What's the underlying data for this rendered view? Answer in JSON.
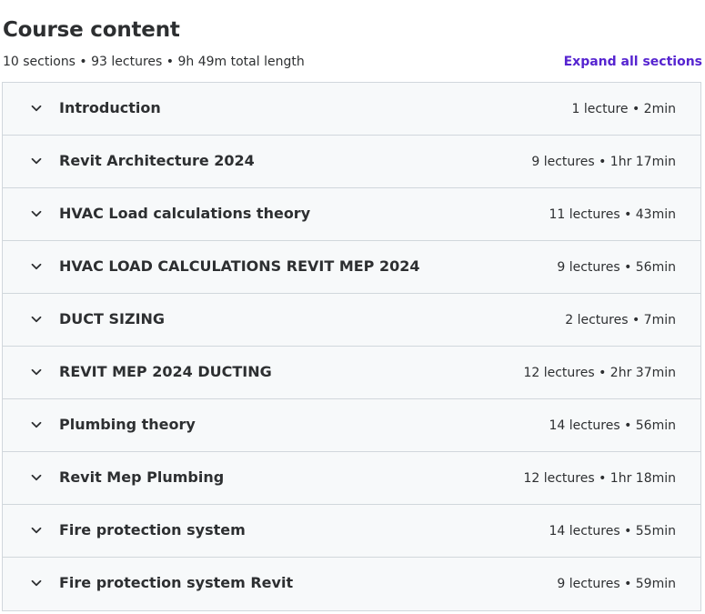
{
  "header": {
    "title": "Course content",
    "summary": "10 sections • 93 lectures • 9h 49m total length",
    "expand_all_label": "Expand all sections"
  },
  "colors": {
    "link": "#5624d0",
    "text": "#2d2f31",
    "border": "#d1d7dc",
    "section_bg": "#f7f9fa"
  },
  "icons": {
    "section_toggle": "chevron-down-icon"
  },
  "sections": [
    {
      "title": "Introduction",
      "meta": "1 lecture • 2min"
    },
    {
      "title": "Revit Architecture 2024",
      "meta": "9 lectures • 1hr 17min"
    },
    {
      "title": "HVAC Load calculations theory",
      "meta": "11 lectures • 43min"
    },
    {
      "title": "HVAC LOAD CALCULATIONS REVIT MEP 2024",
      "meta": "9 lectures • 56min"
    },
    {
      "title": "DUCT SIZING",
      "meta": "2 lectures • 7min"
    },
    {
      "title": "REVIT MEP 2024 DUCTING",
      "meta": "12 lectures • 2hr 37min"
    },
    {
      "title": "Plumbing theory",
      "meta": "14 lectures • 56min"
    },
    {
      "title": "Revit Mep Plumbing",
      "meta": "12 lectures • 1hr 18min"
    },
    {
      "title": "Fire protection system",
      "meta": "14 lectures • 55min"
    },
    {
      "title": "Fire protection system Revit",
      "meta": "9 lectures • 59min"
    }
  ]
}
